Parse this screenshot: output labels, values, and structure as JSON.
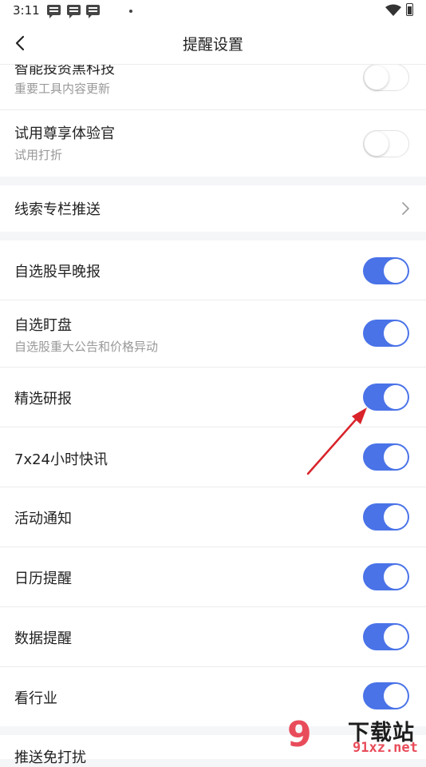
{
  "status_bar": {
    "time": "3:11"
  },
  "header": {
    "title": "提醒设置"
  },
  "rows": [
    {
      "label": "智能投资黑科技",
      "sub": "重要工具内容更新",
      "state": "off"
    },
    {
      "label": "试用尊享体验官",
      "sub": "试用打折",
      "state": "off"
    },
    {
      "label": "线索专栏推送",
      "control": "chevron"
    },
    {
      "label": "自选股早晚报",
      "state": "on"
    },
    {
      "label": "自选盯盘",
      "sub": "自选股重大公告和价格异动",
      "state": "on"
    },
    {
      "label": "精选研报",
      "state": "on"
    },
    {
      "label": "7x24小时快讯",
      "state": "on"
    },
    {
      "label": "活动通知",
      "state": "on"
    },
    {
      "label": "日历提醒",
      "state": "on"
    },
    {
      "label": "数据提醒",
      "state": "on"
    },
    {
      "label": "看行业",
      "state": "on"
    },
    {
      "label": "推送免打扰"
    }
  ],
  "watermark": {
    "glyph": "9",
    "title": "下载站",
    "url": "91xz.net"
  },
  "colors": {
    "toggle_on": "#4a73e8",
    "annotation_arrow": "#d9232a",
    "watermark": "#e84c5a"
  }
}
